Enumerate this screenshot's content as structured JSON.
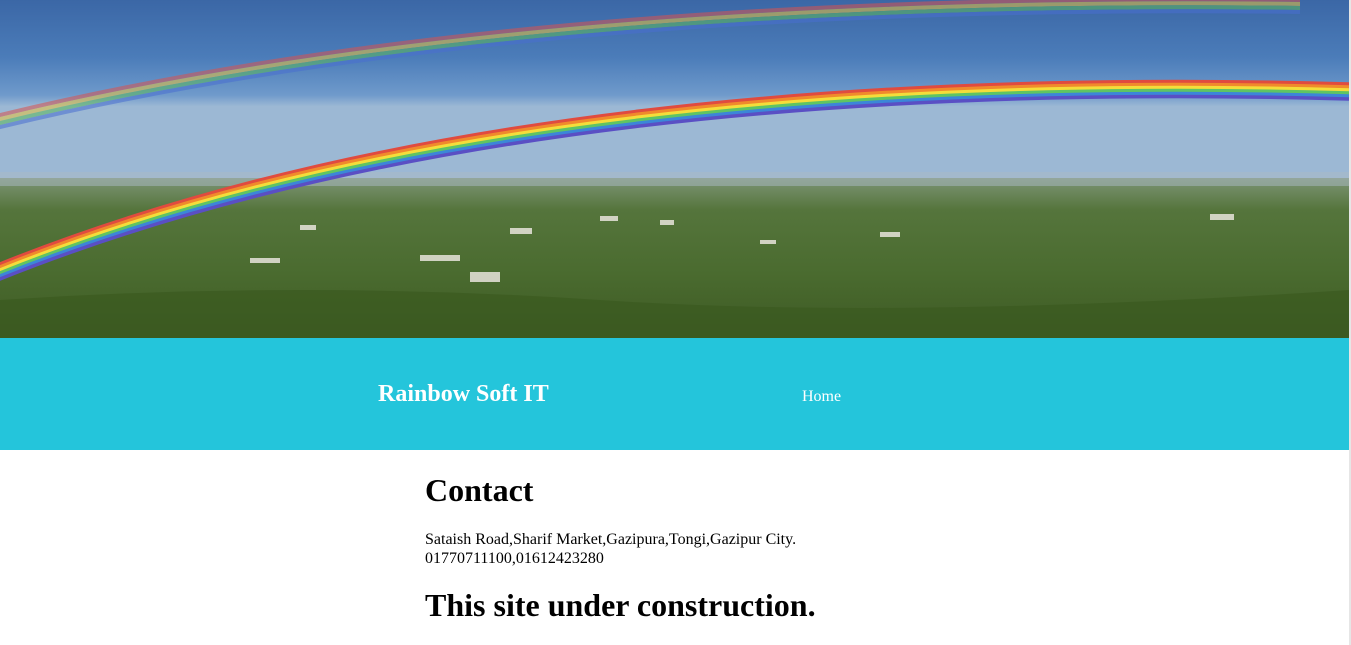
{
  "banner": {
    "image_alt": "rainbow over green hills landscape"
  },
  "navbar": {
    "brand": "Rainbow Soft IT",
    "links": [
      {
        "label": "Home"
      }
    ],
    "background_color": "#24c5db"
  },
  "contact": {
    "title": "Contact",
    "address": "Sataish Road,Sharif Market,Gazipura,Tongi,Gazipur City.",
    "phones": "01770711100,01612423280"
  },
  "notice": {
    "text": "This site under construction."
  }
}
